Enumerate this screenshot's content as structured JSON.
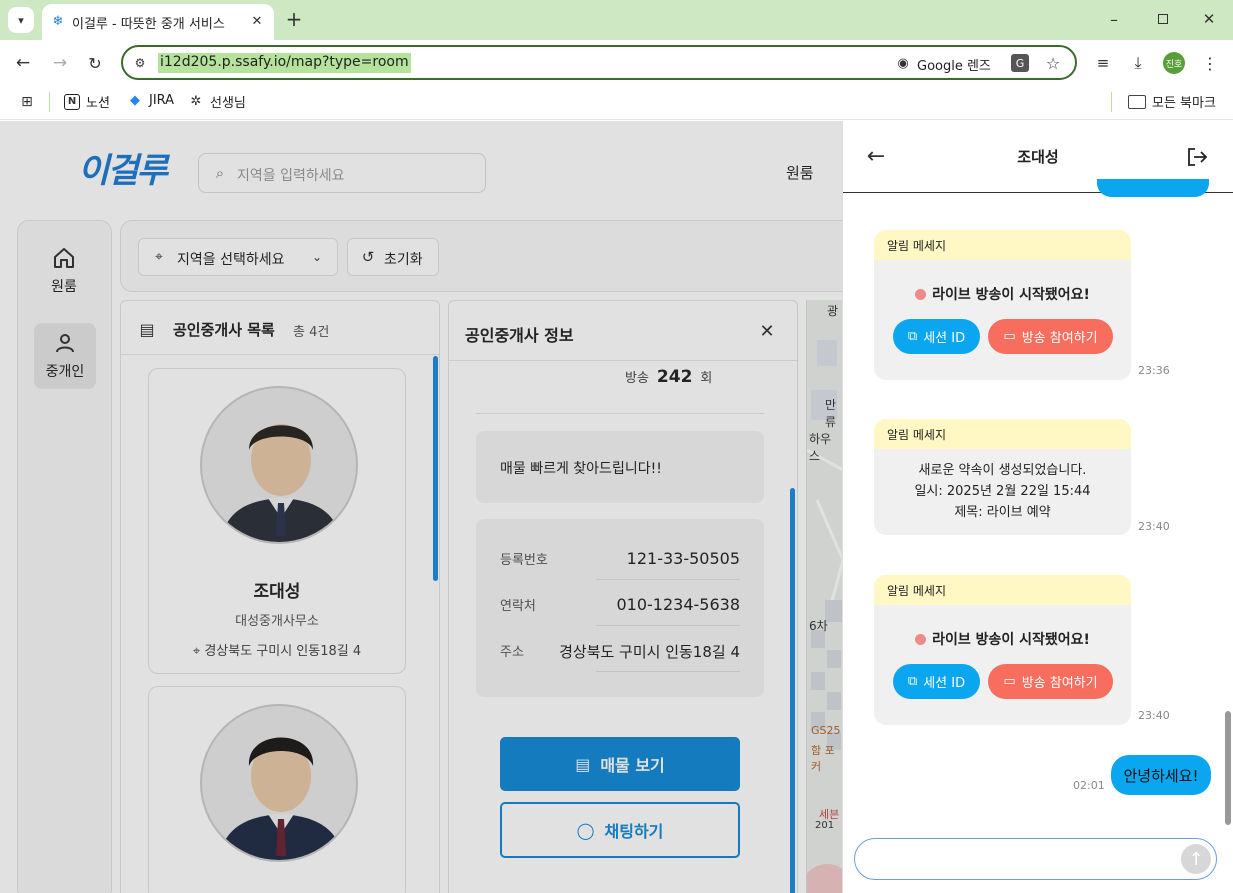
{
  "browser": {
    "tab_title": "이걸루 - 따뜻한 중개 서비스",
    "url": "i12d205.p.ssafy.io/map?type=room",
    "lens_label": "Google 렌즈",
    "profile": "진호",
    "bookmarks": [
      "노션",
      "JIRA",
      "선생님"
    ],
    "all_bookmarks": "모든 북마크"
  },
  "app": {
    "logo": "이걸루",
    "search_placeholder": "지역을 입력하세요",
    "nav_room": "원룸",
    "sidebar": [
      {
        "label": "원룸",
        "icon": "home-icon"
      },
      {
        "label": "중개인",
        "icon": "user-icon"
      }
    ],
    "filter_region": "지역을 선택하세요",
    "filter_reset": "초기화"
  },
  "list": {
    "title": "공인중개사 목록",
    "count": "총 4건",
    "agents": [
      {
        "name": "조대성",
        "office": "대성중개사무소",
        "address": "경상북도 구미시 인동18길 4"
      }
    ]
  },
  "info": {
    "title": "공인중개사 정보",
    "broadcast_label": "방송",
    "broadcast_count": "242",
    "broadcast_unit": "회",
    "intro": "매물 빠르게 찾아드립니다!!",
    "rows": [
      {
        "label": "등록번호",
        "value": "121-33-50505"
      },
      {
        "label": "연락처",
        "value": "010-1234-5638"
      },
      {
        "label": "주소",
        "value": "경상북도 구미시 인동18길 4"
      }
    ],
    "btn_listings": "매물 보기",
    "btn_chat": "채팅하기"
  },
  "map_labels": [
    "광",
    "만류",
    "하우스",
    "6차",
    "GS25",
    "함 포커",
    "세븐",
    "201"
  ],
  "chat": {
    "title": "조대성",
    "messages": [
      {
        "type": "notice",
        "header": "알림 메세지",
        "text": "라이브 방송이 시작됐어요!",
        "btn1": "세션 ID",
        "btn2": "방송 참여하기",
        "time": "23:36"
      },
      {
        "type": "text",
        "header": "알림 메세지",
        "lines": [
          "새로운 약속이 생성되었습니다.",
          "일시: 2025년 2월 22일 15:44",
          "제목: 라이브 예약"
        ],
        "time": "23:40"
      },
      {
        "type": "notice",
        "header": "알림 메세지",
        "text": "라이브 방송이 시작됐어요!",
        "btn1": "세션 ID",
        "btn2": "방송 참여하기",
        "time": "23:40"
      },
      {
        "type": "mine",
        "text": "안녕하세요!",
        "time": "02:01"
      }
    ],
    "input_placeholder": ""
  }
}
